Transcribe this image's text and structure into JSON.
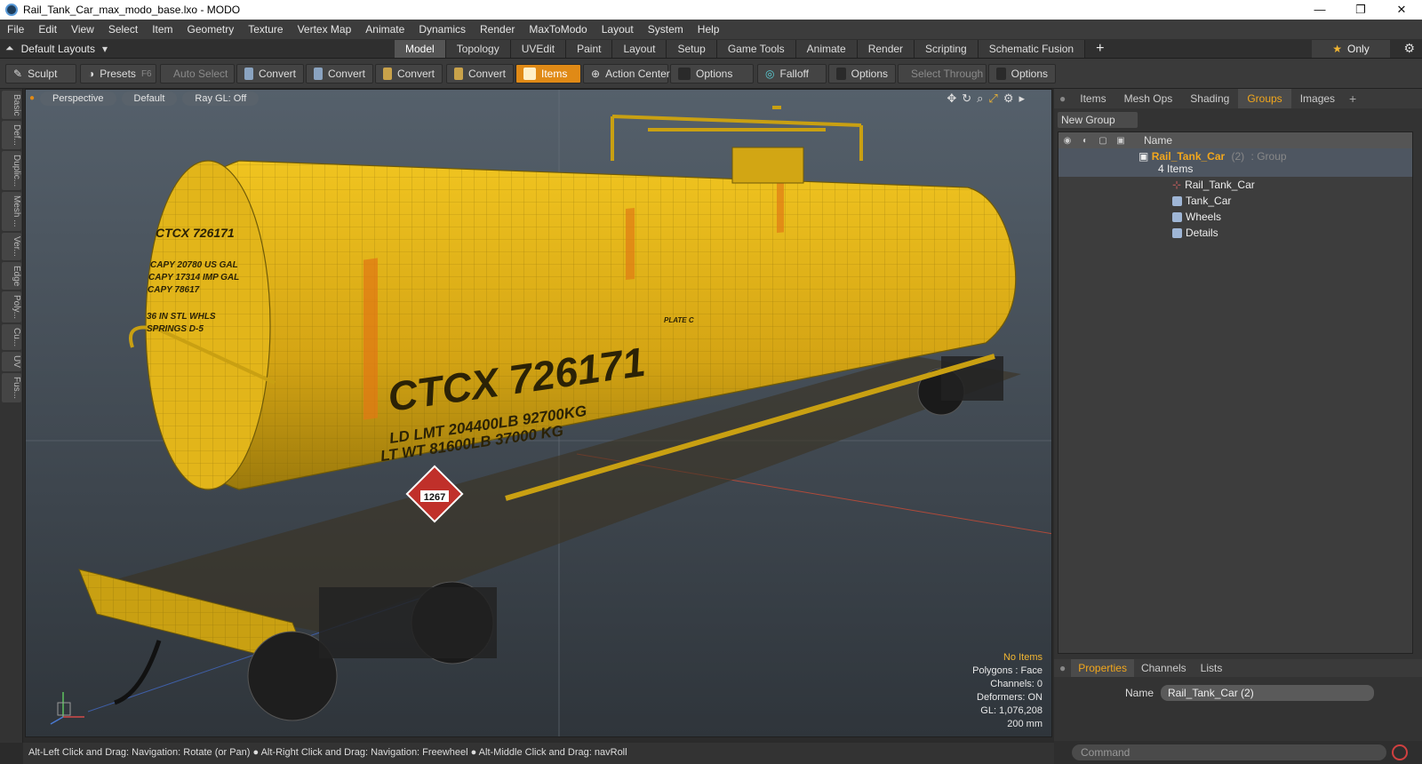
{
  "window": {
    "title": "Rail_Tank_Car_max_modo_base.lxo - MODO",
    "controls": [
      "—",
      "❐",
      "✕"
    ]
  },
  "menu": [
    "File",
    "Edit",
    "View",
    "Select",
    "Item",
    "Geometry",
    "Texture",
    "Vertex Map",
    "Animate",
    "Dynamics",
    "Render",
    "MaxToModo",
    "Layout",
    "System",
    "Help"
  ],
  "layouts": {
    "label": "Default Layouts"
  },
  "tabs": [
    "Model",
    "Topology",
    "UVEdit",
    "Paint",
    "Layout",
    "Setup",
    "Game Tools",
    "Animate",
    "Render",
    "Scripting",
    "Schematic Fusion"
  ],
  "only": "Only",
  "toolbar": {
    "sculpt": "Sculpt",
    "presets": "Presets",
    "presets_key": "F6",
    "auto_select": "Auto Select",
    "convert": "Convert",
    "items": "Items",
    "action_center": "Action Center",
    "options": "Options",
    "falloff": "Falloff",
    "select_through": "Select Through"
  },
  "left_tabs": [
    "Basic",
    "Def...",
    "Duplic...",
    "Mesh ...",
    "Ver...",
    "Edge",
    "Poly...",
    "Cu...",
    "UV",
    "Fus..."
  ],
  "viewport": {
    "perspective": "Perspective",
    "shading": "Default",
    "raygl": "Ray GL: Off",
    "info": {
      "items": "No Items",
      "polygons": "Polygons : Face",
      "channels": "Channels: 0",
      "deformers": "Deformers: ON",
      "gl": "GL: 1,076,208",
      "scale": "200 mm"
    }
  },
  "status": "Alt-Left Click and Drag: Navigation: Rotate (or Pan) ● Alt-Right Click and Drag: Navigation: Freewheel ● Alt-Middle Click and Drag: navRoll",
  "panel": {
    "tabs": [
      "Items",
      "Mesh Ops",
      "Shading",
      "Groups",
      "Images"
    ],
    "new_group": "New Group",
    "name_col": "Name",
    "group": {
      "name": "Rail_Tank_Car",
      "count": "(2)",
      "type": ": Group",
      "items": "4 Items"
    },
    "children": [
      "Rail_Tank_Car",
      "Tank_Car",
      "Wheels",
      "Details"
    ]
  },
  "properties": {
    "tabs": [
      "Properties",
      "Channels",
      "Lists"
    ],
    "name_label": "Name",
    "name_value": "Rail_Tank_Car (2)"
  },
  "command": {
    "placeholder": "Command"
  },
  "car_text": {
    "reporting_mark": "CTCX 726171",
    "small_mark": "CTCX 726171",
    "cap_gal": "CAPY 20780 US GAL",
    "cap_imp": "CAPY 17314 IMP GAL",
    "cap_l": "CAPY 78617",
    "wheels": "36 IN STL WHLS",
    "springs": "SPRINGS D-5",
    "ld_lmt": "LD LMT 204400LB 92700KG",
    "lt_wt": "LT WT    81600LB 37000 KG",
    "placard": "1267",
    "plate": "PLATE C"
  },
  "colors": {
    "accent": "#f2a71c",
    "car_yellow": "#e0b21a"
  }
}
